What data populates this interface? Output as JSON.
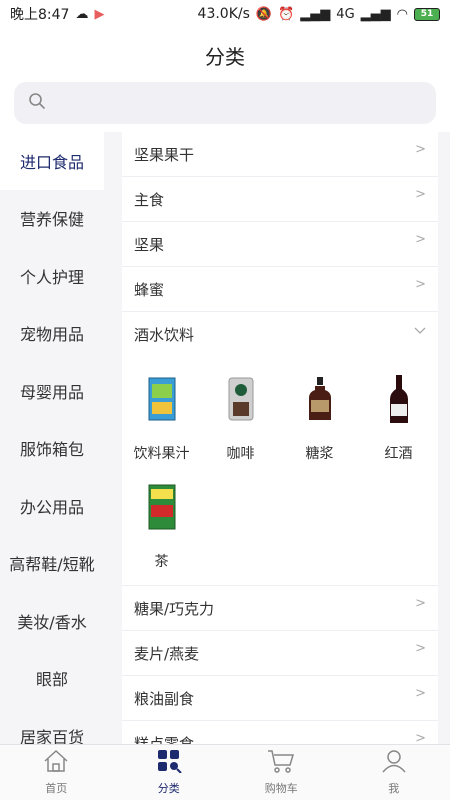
{
  "status": {
    "time": "晚上8:47",
    "network_speed": "43.0K/s",
    "signal_type": "4G",
    "battery": "51"
  },
  "header": {
    "title": "分类"
  },
  "search": {
    "placeholder": ""
  },
  "sidebar": {
    "items": [
      {
        "label": "进口食品",
        "active": true
      },
      {
        "label": "营养保健"
      },
      {
        "label": "个人护理"
      },
      {
        "label": "宠物用品"
      },
      {
        "label": "母婴用品"
      },
      {
        "label": "服饰箱包"
      },
      {
        "label": "办公用品"
      },
      {
        "label": "高帮鞋/短靴"
      },
      {
        "label": "美妆/香水"
      },
      {
        "label": "眼部"
      },
      {
        "label": "居家百货"
      }
    ]
  },
  "categories": {
    "top": [
      {
        "label": "坚果果干"
      },
      {
        "label": "主食"
      },
      {
        "label": "坚果"
      },
      {
        "label": "蜂蜜"
      }
    ],
    "expanded": {
      "label": "酒水饮料",
      "subitems": [
        {
          "label": "饮料果汁",
          "icon": "juice-box-image"
        },
        {
          "label": "咖啡",
          "icon": "coffee-bag-image"
        },
        {
          "label": "糖浆",
          "icon": "syrup-bottle-image"
        },
        {
          "label": "红酒",
          "icon": "wine-bottle-image"
        },
        {
          "label": "茶",
          "icon": "green-tea-box-image"
        }
      ]
    },
    "bottom": [
      {
        "label": "糖果/巧克力"
      },
      {
        "label": "麦片/燕麦"
      },
      {
        "label": "粮油副食"
      },
      {
        "label": "糕点零食"
      }
    ]
  },
  "tabbar": {
    "items": [
      {
        "label": "首页",
        "icon": "home-icon"
      },
      {
        "label": "分类",
        "icon": "category-icon",
        "active": true
      },
      {
        "label": "购物车",
        "icon": "cart-icon"
      },
      {
        "label": "我",
        "icon": "user-icon"
      }
    ]
  },
  "colors": {
    "accent": "#1e2a6e",
    "sidebar_bg": "#f5f5f8"
  }
}
